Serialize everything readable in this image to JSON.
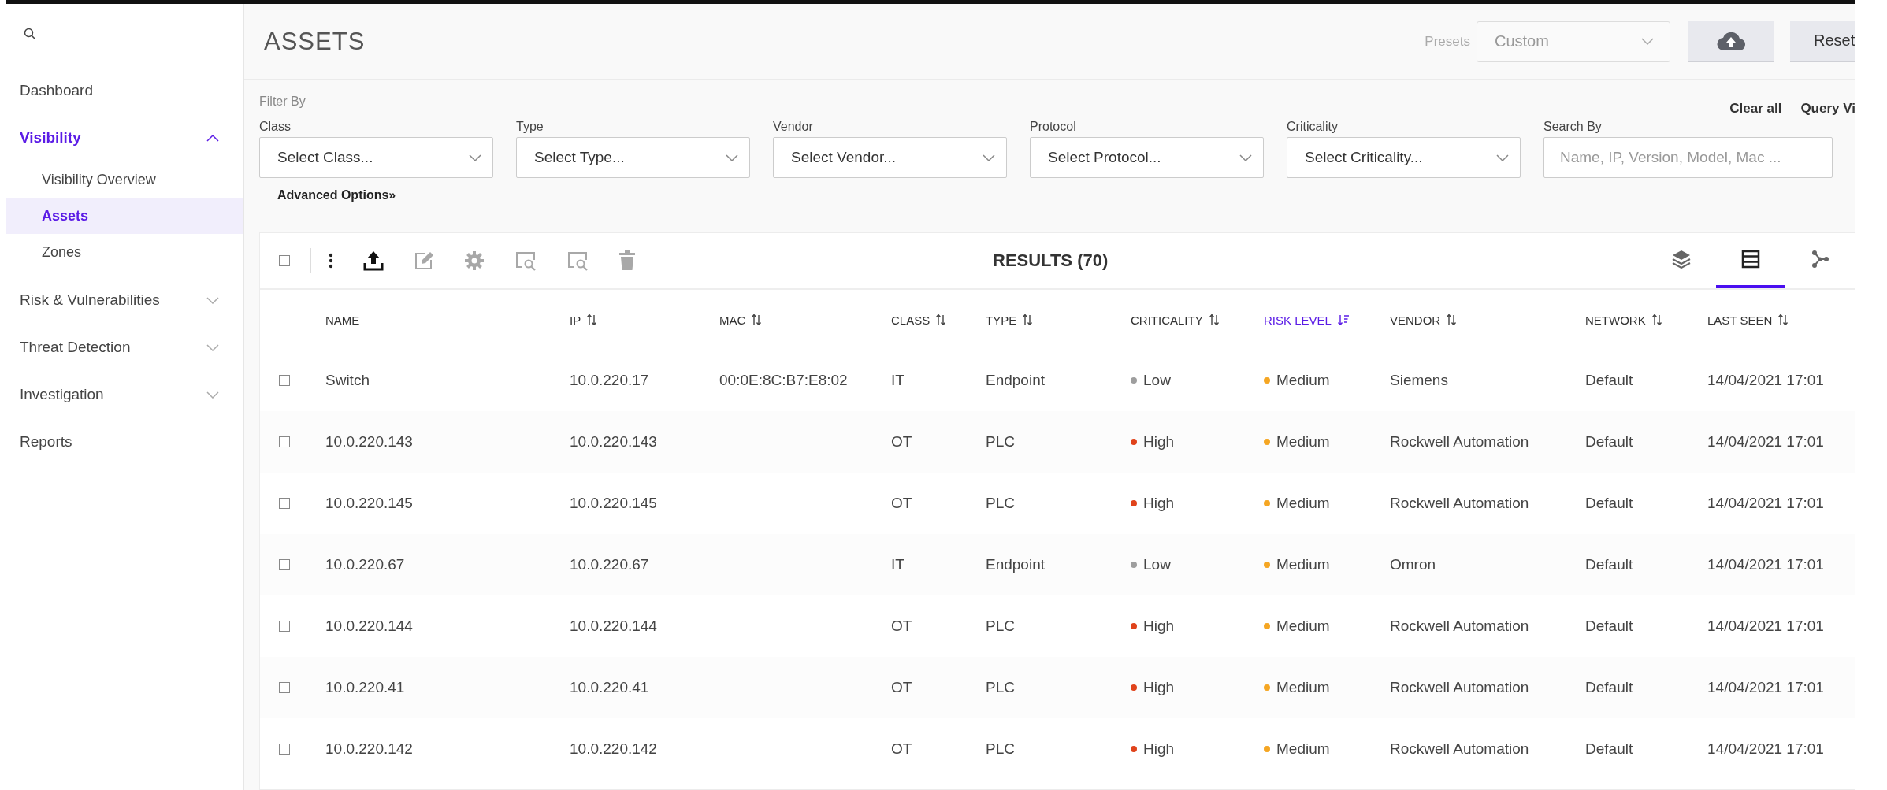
{
  "sidebar": {
    "items": [
      {
        "label": "Dashboard",
        "selected": false
      },
      {
        "label": "Visibility",
        "expanded": true,
        "selected": true,
        "children": [
          {
            "label": "Visibility Overview",
            "selected": false
          },
          {
            "label": "Assets",
            "selected": true
          },
          {
            "label": "Zones",
            "selected": false
          }
        ]
      },
      {
        "label": "Risk & Vulnerabilities",
        "expanded": false,
        "selected": false
      },
      {
        "label": "Threat Detection",
        "expanded": false,
        "selected": false
      },
      {
        "label": "Investigation",
        "expanded": false,
        "selected": false
      },
      {
        "label": "Reports",
        "selected": false
      }
    ]
  },
  "header": {
    "title": "ASSETS",
    "presets_label": "Presets",
    "presets": {
      "value": "Custom"
    },
    "reset": "Reset"
  },
  "filters": {
    "heading": "Filter By",
    "clear_all": "Clear all",
    "query_view": "Query Vi",
    "selects": [
      {
        "label": "Class",
        "placeholder": "Select Class..."
      },
      {
        "label": "Type",
        "placeholder": "Select Type..."
      },
      {
        "label": "Vendor",
        "placeholder": "Select Vendor..."
      },
      {
        "label": "Protocol",
        "placeholder": "Select Protocol..."
      },
      {
        "label": "Criticality",
        "placeholder": "Select Criticality..."
      }
    ],
    "search": {
      "label": "Search By",
      "placeholder": "Name, IP, Version, Model, Mac ..."
    },
    "advanced": "Advanced Options»"
  },
  "results": {
    "title": "RESULTS (70)",
    "select_all": {
      "checked": false
    },
    "actions": [
      {
        "kind": "more",
        "disabled": false
      },
      {
        "kind": "export",
        "disabled": false
      },
      {
        "kind": "edit",
        "disabled": true
      },
      {
        "kind": "settings",
        "disabled": true
      },
      {
        "kind": "scan",
        "disabled": true
      },
      {
        "kind": "scan",
        "disabled": true
      },
      {
        "kind": "delete",
        "disabled": true
      }
    ],
    "views": [
      {
        "kind": "layers",
        "selected": false
      },
      {
        "kind": "list",
        "selected": true
      },
      {
        "kind": "graph",
        "selected": false
      }
    ],
    "columns": [
      {
        "label": "NAME",
        "sortable": false,
        "sorted": false
      },
      {
        "label": "IP",
        "sortable": true,
        "sorted": false
      },
      {
        "label": "MAC",
        "sortable": true,
        "sorted": false
      },
      {
        "label": "CLASS",
        "sortable": true,
        "sorted": false
      },
      {
        "label": "TYPE",
        "sortable": true,
        "sorted": false
      },
      {
        "label": "CRITICALITY",
        "sortable": true,
        "sorted": false
      },
      {
        "label": "RISK LEVEL",
        "sortable": true,
        "sorted": true
      },
      {
        "label": "VENDOR",
        "sortable": true,
        "sorted": false
      },
      {
        "label": "NETWORK",
        "sortable": true,
        "sorted": false
      },
      {
        "label": "LAST SEEN",
        "sortable": true,
        "sorted": false
      }
    ],
    "rows": [
      {
        "checked": false,
        "name": "Switch",
        "ip": "10.0.220.17",
        "mac": "00:0E:8C:B7:E8:02",
        "class": "IT",
        "type": "Endpoint",
        "criticality": {
          "label": "Low",
          "color": "#9e9e9e"
        },
        "risk": {
          "label": "Medium",
          "color": "#f5a623"
        },
        "vendor": "Siemens",
        "network": "Default",
        "last_seen": "14/04/2021 17:01"
      },
      {
        "checked": false,
        "name": "10.0.220.143",
        "ip": "10.0.220.143",
        "class": "OT",
        "type": "PLC",
        "criticality": {
          "label": "High",
          "color": "#e0431b"
        },
        "risk": {
          "label": "Medium",
          "color": "#f5a623"
        },
        "vendor": "Rockwell Automation",
        "network": "Default",
        "last_seen": "14/04/2021 17:01"
      },
      {
        "checked": false,
        "name": "10.0.220.145",
        "ip": "10.0.220.145",
        "class": "OT",
        "type": "PLC",
        "criticality": {
          "label": "High",
          "color": "#e0431b"
        },
        "risk": {
          "label": "Medium",
          "color": "#f5a623"
        },
        "vendor": "Rockwell Automation",
        "network": "Default",
        "last_seen": "14/04/2021 17:01"
      },
      {
        "checked": false,
        "name": "10.0.220.67",
        "ip": "10.0.220.67",
        "class": "IT",
        "type": "Endpoint",
        "criticality": {
          "label": "Low",
          "color": "#9e9e9e"
        },
        "risk": {
          "label": "Medium",
          "color": "#f5a623"
        },
        "vendor": "Omron",
        "network": "Default",
        "last_seen": "14/04/2021 17:01"
      },
      {
        "checked": false,
        "name": "10.0.220.144",
        "ip": "10.0.220.144",
        "class": "OT",
        "type": "PLC",
        "criticality": {
          "label": "High",
          "color": "#e0431b"
        },
        "risk": {
          "label": "Medium",
          "color": "#f5a623"
        },
        "vendor": "Rockwell Automation",
        "network": "Default",
        "last_seen": "14/04/2021 17:01"
      },
      {
        "checked": false,
        "name": "10.0.220.41",
        "ip": "10.0.220.41",
        "class": "OT",
        "type": "PLC",
        "criticality": {
          "label": "High",
          "color": "#e0431b"
        },
        "risk": {
          "label": "Medium",
          "color": "#f5a623"
        },
        "vendor": "Rockwell Automation",
        "network": "Default",
        "last_seen": "14/04/2021 17:01"
      },
      {
        "checked": false,
        "name": "10.0.220.142",
        "ip": "10.0.220.142",
        "class": "OT",
        "type": "PLC",
        "criticality": {
          "label": "High",
          "color": "#e0431b"
        },
        "risk": {
          "label": "Medium",
          "color": "#f5a623"
        },
        "vendor": "Rockwell Automation",
        "network": "Default",
        "last_seen": "14/04/2021 17:01"
      }
    ]
  }
}
